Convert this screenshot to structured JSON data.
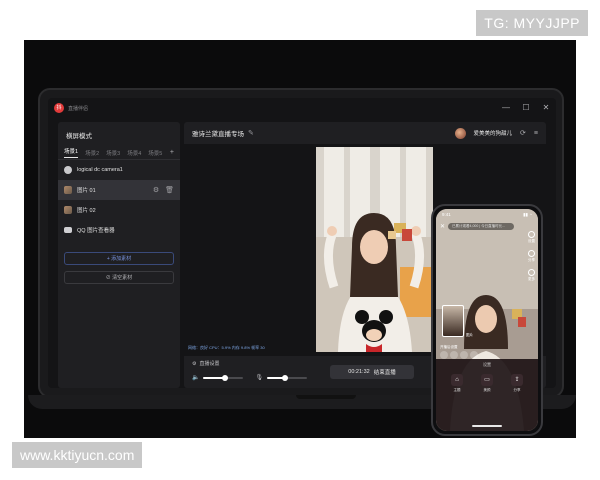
{
  "watermarks": {
    "top": "TG: MYYJJPP",
    "bottom": "www.kktiyucn.com"
  },
  "window": {
    "app_name": "直播伴侣",
    "controls": [
      "—",
      "☐",
      "✕"
    ]
  },
  "sidebar": {
    "title": "横屏模式",
    "scenes": [
      "场景1",
      "场景2",
      "场景3",
      "场景4",
      "场景5"
    ],
    "add_scene": "+",
    "sources": [
      {
        "label": "logical dc camera1",
        "icon": "camera-icon"
      },
      {
        "label": "图片 01",
        "icon": "image-icon",
        "selected": true
      },
      {
        "label": "图片 02",
        "icon": "image-icon"
      },
      {
        "label": "QQ 图片查看器",
        "icon": "monitor-icon"
      }
    ],
    "add_material_label": "+ 添加素材",
    "clear_material_label": "⊘ 清空素材"
  },
  "header": {
    "room_title": "雅诗兰黛直播专场",
    "user_name": "爱美美的狗甜儿"
  },
  "stats": "网络：良好  CPU：5.9% 内存 9.8% 帧率 30",
  "controls": {
    "settings_label": "直播设置",
    "mic_volume": 0.45,
    "speaker_volume": 0.55,
    "timer": "00:21:32",
    "stop_label": "结束直播"
  },
  "phone": {
    "time": "9:41",
    "pill_text": "已累计观看4,000 | 今日直播时长...",
    "side_items": [
      "设置",
      "分享",
      "更多"
    ],
    "pip_label": "图片",
    "sheet_title": "设置",
    "sheet_items": [
      {
        "label": "主题",
        "icon": "home-icon"
      },
      {
        "label": "美颜",
        "icon": "chat-icon"
      },
      {
        "label": "分享",
        "icon": "share-icon"
      }
    ],
    "float_label": "开播后设置"
  }
}
